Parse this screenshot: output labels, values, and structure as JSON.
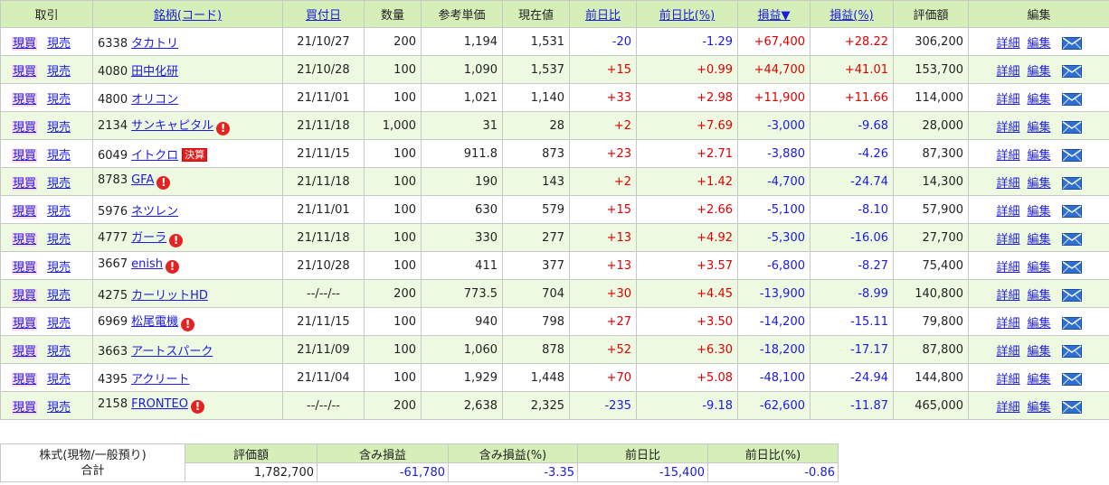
{
  "headers": {
    "trade": "取引",
    "name": "銘柄(コード)",
    "date": "買付日",
    "qty": "数量",
    "ref_price": "参考単価",
    "cur_price": "現在値",
    "day_change": "前日比",
    "day_change_pct": "前日比(%)",
    "pnl": "損益▼",
    "pnl_pct": "損益(%)",
    "value": "評価額",
    "edit": "編集"
  },
  "labels": {
    "buy": "現買",
    "sell": "現売",
    "detail": "詳細",
    "edit": "編集",
    "alert": "!",
    "earnings_badge": "決算"
  },
  "rows": [
    {
      "code": "6338",
      "name": "タカトリ",
      "alert": false,
      "badge": false,
      "date": "21/10/27",
      "qty": "200",
      "ref": "1,194",
      "cur": "1,531",
      "chg": "-20",
      "chg_pct": "-1.29",
      "pnl": "+67,400",
      "pnl_pct": "+28.22",
      "value": "306,200"
    },
    {
      "code": "4080",
      "name": "田中化研",
      "alert": false,
      "badge": false,
      "date": "21/10/28",
      "qty": "100",
      "ref": "1,090",
      "cur": "1,537",
      "chg": "+15",
      "chg_pct": "+0.99",
      "pnl": "+44,700",
      "pnl_pct": "+41.01",
      "value": "153,700"
    },
    {
      "code": "4800",
      "name": "オリコン",
      "alert": false,
      "badge": false,
      "date": "21/11/01",
      "qty": "100",
      "ref": "1,021",
      "cur": "1,140",
      "chg": "+33",
      "chg_pct": "+2.98",
      "pnl": "+11,900",
      "pnl_pct": "+11.66",
      "value": "114,000"
    },
    {
      "code": "2134",
      "name": "サンキャピタル",
      "alert": true,
      "badge": false,
      "date": "21/11/18",
      "qty": "1,000",
      "ref": "31",
      "cur": "28",
      "chg": "+2",
      "chg_pct": "+7.69",
      "pnl": "-3,000",
      "pnl_pct": "-9.68",
      "value": "28,000"
    },
    {
      "code": "6049",
      "name": "イトクロ",
      "alert": false,
      "badge": true,
      "date": "21/11/15",
      "qty": "100",
      "ref": "911.8",
      "cur": "873",
      "chg": "+23",
      "chg_pct": "+2.71",
      "pnl": "-3,880",
      "pnl_pct": "-4.26",
      "value": "87,300"
    },
    {
      "code": "8783",
      "name": "GFA",
      "alert": true,
      "badge": false,
      "date": "21/11/18",
      "qty": "100",
      "ref": "190",
      "cur": "143",
      "chg": "+2",
      "chg_pct": "+1.42",
      "pnl": "-4,700",
      "pnl_pct": "-24.74",
      "value": "14,300"
    },
    {
      "code": "5976",
      "name": "ネツレン",
      "alert": false,
      "badge": false,
      "date": "21/11/01",
      "qty": "100",
      "ref": "630",
      "cur": "579",
      "chg": "+15",
      "chg_pct": "+2.66",
      "pnl": "-5,100",
      "pnl_pct": "-8.10",
      "value": "57,900"
    },
    {
      "code": "4777",
      "name": "ガーラ",
      "alert": true,
      "badge": false,
      "date": "21/11/18",
      "qty": "100",
      "ref": "330",
      "cur": "277",
      "chg": "+13",
      "chg_pct": "+4.92",
      "pnl": "-5,300",
      "pnl_pct": "-16.06",
      "value": "27,700"
    },
    {
      "code": "3667",
      "name": "enish",
      "alert": true,
      "badge": false,
      "date": "21/10/28",
      "qty": "100",
      "ref": "411",
      "cur": "377",
      "chg": "+13",
      "chg_pct": "+3.57",
      "pnl": "-6,800",
      "pnl_pct": "-8.27",
      "value": "75,400"
    },
    {
      "code": "4275",
      "name": "カーリットHD",
      "alert": false,
      "badge": false,
      "date": "--/--/--",
      "qty": "200",
      "ref": "773.5",
      "cur": "704",
      "chg": "+30",
      "chg_pct": "+4.45",
      "pnl": "-13,900",
      "pnl_pct": "-8.99",
      "value": "140,800"
    },
    {
      "code": "6969",
      "name": "松尾電機",
      "alert": true,
      "badge": false,
      "date": "21/11/15",
      "qty": "100",
      "ref": "940",
      "cur": "798",
      "chg": "+27",
      "chg_pct": "+3.50",
      "pnl": "-14,200",
      "pnl_pct": "-15.11",
      "value": "79,800"
    },
    {
      "code": "3663",
      "name": "アートスパーク",
      "alert": false,
      "badge": false,
      "date": "21/11/09",
      "qty": "100",
      "ref": "1,060",
      "cur": "878",
      "chg": "+52",
      "chg_pct": "+6.30",
      "pnl": "-18,200",
      "pnl_pct": "-17.17",
      "value": "87,800"
    },
    {
      "code": "4395",
      "name": "アクリート",
      "alert": false,
      "badge": false,
      "date": "21/11/04",
      "qty": "100",
      "ref": "1,929",
      "cur": "1,448",
      "chg": "+70",
      "chg_pct": "+5.08",
      "pnl": "-48,100",
      "pnl_pct": "-24.94",
      "value": "144,800"
    },
    {
      "code": "2158",
      "name": "FRONTEO",
      "alert": true,
      "badge": false,
      "date": "--/--/--",
      "qty": "200",
      "ref": "2,638",
      "cur": "2,325",
      "chg": "-235",
      "chg_pct": "-9.18",
      "pnl": "-62,600",
      "pnl_pct": "-11.87",
      "value": "465,000"
    }
  ],
  "summary": {
    "label_line1": "株式(現物/一般預り)",
    "label_line2": "合計",
    "headers": {
      "value": "評価額",
      "unrealized": "含み損益",
      "unrealized_pct": "含み損益(%)",
      "day_change": "前日比",
      "day_change_pct": "前日比(%)"
    },
    "value": "1,782,700",
    "unrealized": "-61,780",
    "unrealized_pct": "-3.35",
    "day_change": "-15,400",
    "day_change_pct": "-0.86"
  },
  "colors": {
    "header_bg": "#d6efb9",
    "alt_row_bg": "#eef9e2",
    "positive": "#e00000",
    "negative": "#1a1ae0",
    "link": "#1a1ae0"
  },
  "icons": {
    "mail": "mail-envelope-icon",
    "alert": "alert-exclamation-icon"
  }
}
